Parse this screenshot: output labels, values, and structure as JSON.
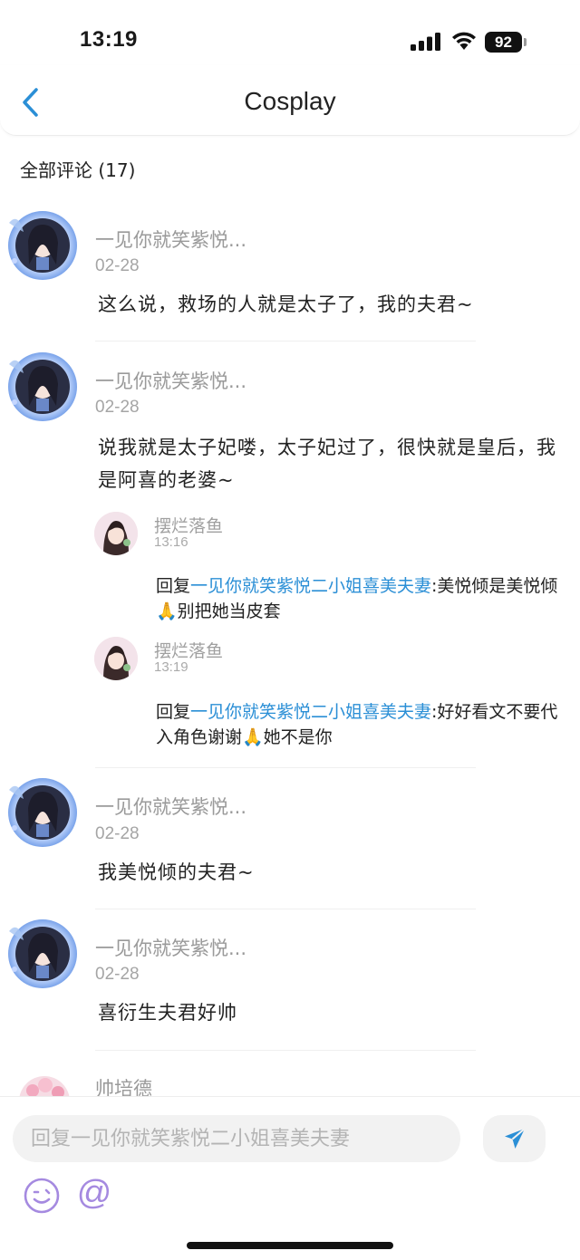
{
  "status": {
    "time": "13:19",
    "battery": "92"
  },
  "nav": {
    "title": "Cosplay"
  },
  "comments_heading": "全部评论 (17)",
  "comments": [
    {
      "name": "一见你就笑紫悦...",
      "date": "02-28",
      "text": "这么说，救场的人就是太子了，我的夫君~"
    },
    {
      "name": "一见你就笑紫悦...",
      "date": "02-28",
      "text": "说我就是太子妃喽，太子妃过了，很快就是皇后，我是阿喜的老婆~"
    },
    {
      "name": "一见你就笑紫悦...",
      "date": "02-28",
      "text": "我美悦倾的夫君~"
    },
    {
      "name": "一见你就笑紫悦...",
      "date": "02-28",
      "text": "喜衍生夫君好帅"
    }
  ],
  "replies": [
    {
      "name": "摆烂落鱼",
      "time": "13:16",
      "prefix": "回复",
      "target": "一见你就笑紫悦二小姐喜美夫妻",
      "text": ":美悦倾是美悦倾🙏别把她当皮套"
    },
    {
      "name": "摆烂落鱼",
      "time": "13:19",
      "prefix": "回复",
      "target": "一见你就笑紫悦二小姐喜美夫妻",
      "text": ":好好看文不要代入角色谢谢🙏她不是你"
    }
  ],
  "partial_comment": {
    "name": "帅培德"
  },
  "input": {
    "placeholder": "回复一见你就笑紫悦二小姐喜美夫妻",
    "at_symbol": "@"
  },
  "icons": {
    "back": "chevron-left-icon",
    "send": "paper-plane-icon",
    "emoji": "smiley-icon",
    "signal": "cellular-signal-icon",
    "wifi": "wifi-icon"
  },
  "colors": {
    "accent": "#2b8fd6",
    "emoji_purple": "#a58ae0"
  }
}
